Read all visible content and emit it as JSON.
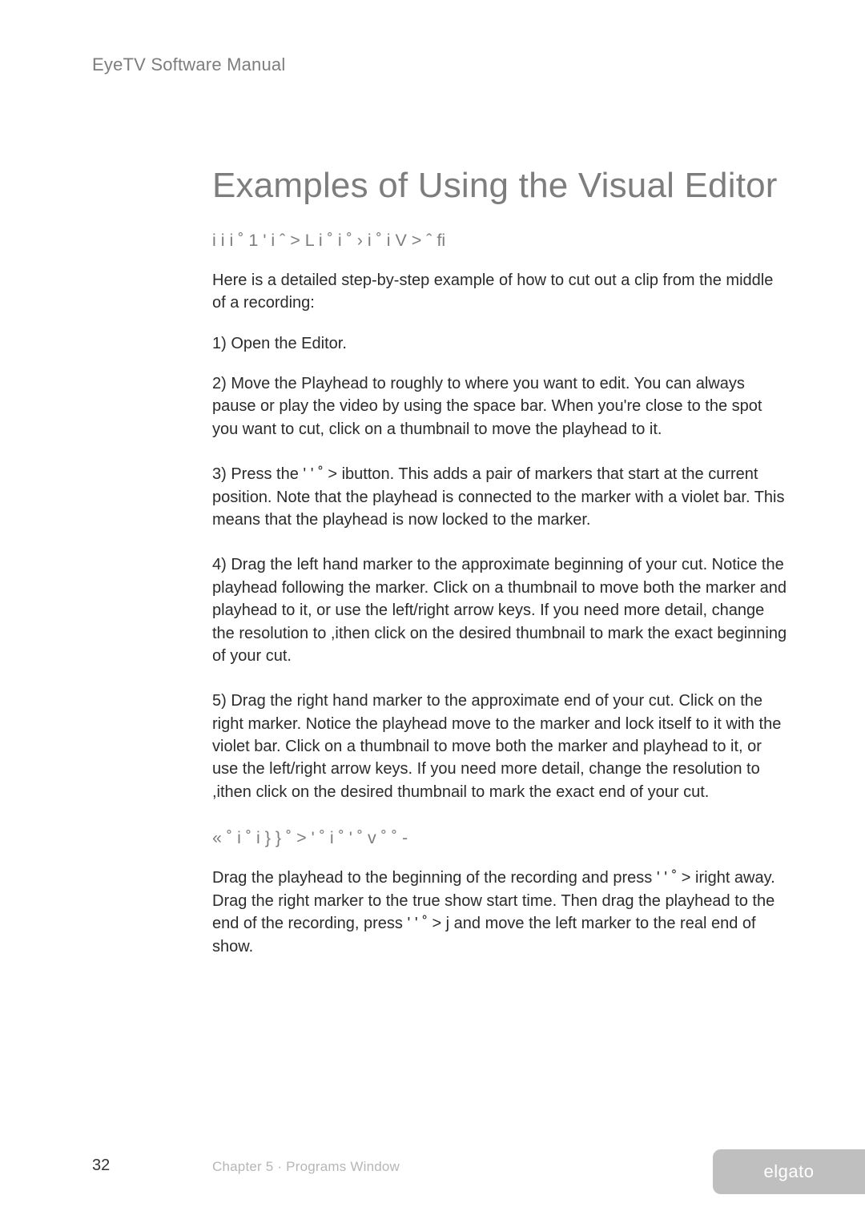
{
  "header": {
    "running_title": "EyeTV Software Manual"
  },
  "main": {
    "title": "Examples of Using the Visual Editor",
    "subheading1": "i  i  i ˚ 1  ' i ˆ    > L  i ˚     i   ˚ ›    i ˚     i  V  >  ˆ fi",
    "paragraphs": {
      "intro": "Here is a detailed step-by-step example of how to cut out a clip from the middle of a recording:",
      "step1": "1) Open the Editor.",
      "step2": "2) Move the Playhead to roughly to where you want to edit. You can always pause or play the video by using the space bar. When you're close to the spot you want to cut, click on a thumbnail to move the playhead to it.",
      "step3": "3) Press the   ' ' ˚  >    ibutton. This adds a pair of markers that start at the current position. Note that the playhead is connected to the marker with a violet bar. This means that the playhead is now locked to the marker.",
      "step4": "4) Drag the left hand marker to the approximate beginning of your cut. Notice the playhead following the marker. Click on a thumbnail to move both the marker and playhead to it, or use the left/right arrow keys. If you need more detail, change the resolution to     ,ithen click on the desired thumbnail to mark the exact beginning of your cut.",
      "step5": "5) Drag the right hand marker to the approximate end of your cut. Click on the right marker. Notice the playhead move to the marker and lock itself to it with the violet bar. Click on a thumbnail to move both the marker and playhead to it, or use the left/right arrow keys. If you need more detail, change the resolution to     ,ithen click on the desired thumbnail to mark the exact end of your cut."
    },
    "subheading2": "« ˚   i ˚  i }      } ˚ >  ' ˚   i ˚   ' ˚  v ˚      ˚ -",
    "paragraph6": "Drag the playhead to the beginning of the recording and press   ' ' ˚  >    iright away. Drag the right marker to the true show start time. Then drag the playhead to the end of the recording, press   ' ' ˚  >    j and move the left marker to the real end of show."
  },
  "footer": {
    "page_number": "32",
    "chapter": "Chapter 5 · Programs Window",
    "brand": "elgato"
  }
}
